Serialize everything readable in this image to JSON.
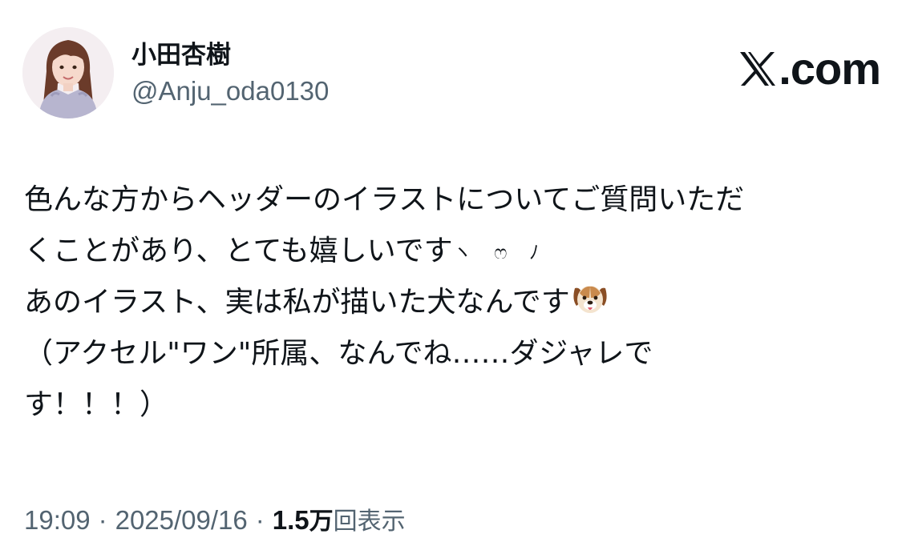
{
  "author": {
    "display_name": "小田杏樹",
    "handle": "@Anju_oda0130"
  },
  "brand": {
    "text": ".com",
    "icon": "x-logo-icon"
  },
  "tweet": {
    "lines": [
      "色んな方からヘッダーのイラストについてご質問いただ",
      "くことがあり、とても嬉しいです",
      "あのイラスト、実は私が描いた犬なんです",
      "（アクセル\"ワン\"所属、なんでね……ダジャレで",
      "す！！！）"
    ],
    "kaomoji": "ヽ ෆ ﾉ",
    "emoji": "dog-face-icon"
  },
  "meta": {
    "time": "19:09",
    "separator": "·",
    "date": "2025/09/16",
    "views_count": "1.5",
    "views_unit": "万",
    "views_label": "回表示"
  },
  "colors": {
    "text_primary": "#0f1419",
    "text_secondary": "#536471",
    "background": "#ffffff"
  }
}
